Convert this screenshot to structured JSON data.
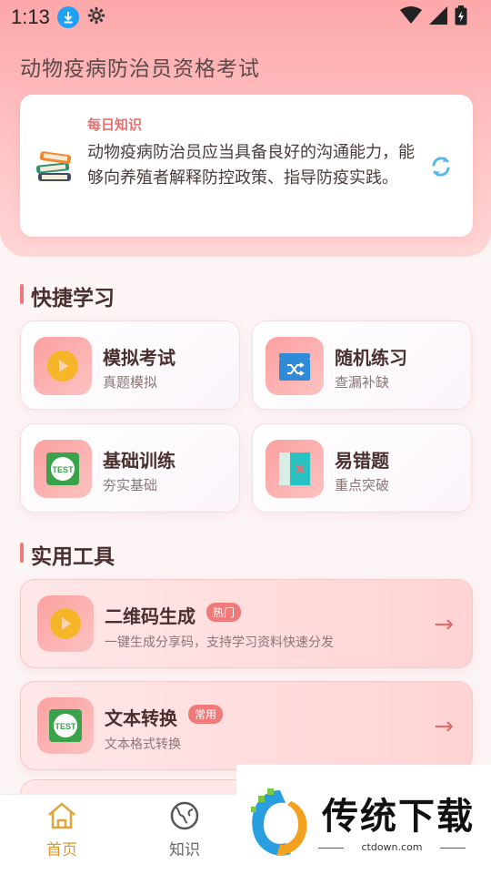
{
  "status_bar": {
    "time": "1:13"
  },
  "app_title": "动物疫病防治员资格考试",
  "daily": {
    "label": "每日知识",
    "text": "动物疫病防治员应当具备良好的沟通能力，能够向养殖者解释防控政策、指导防疫实践。"
  },
  "quick_section_title": "快捷学习",
  "quick": [
    {
      "title": "模拟考试",
      "sub": "真题模拟",
      "icon": "play-icon"
    },
    {
      "title": "随机练习",
      "sub": "查漏补缺",
      "icon": "shuffle-icon"
    },
    {
      "title": "基础训练",
      "sub": "夯实基础",
      "icon": "test-icon"
    },
    {
      "title": "易错题",
      "sub": "重点突破",
      "icon": "wrong-book-icon"
    }
  ],
  "tools_section_title": "实用工具",
  "tools": [
    {
      "title": "二维码生成",
      "badge": "热门",
      "sub": "一键生成分享码，支持学习资料快速分发",
      "arrow": "→",
      "icon": "play-icon"
    },
    {
      "title": "文本转换",
      "badge": "常用",
      "sub": "文本格式转换",
      "arrow": "→",
      "icon": "test-icon"
    }
  ],
  "nav": [
    {
      "label": "首页",
      "active": true,
      "icon": "home-icon"
    },
    {
      "label": "知识",
      "active": false,
      "icon": "globe-icon"
    }
  ],
  "watermark": {
    "text": "传统下载",
    "url": "ctdown.com"
  },
  "colors": {
    "accent": "#f07a7a",
    "nav_active": "#d9982c",
    "nav_inactive": "#666666"
  }
}
